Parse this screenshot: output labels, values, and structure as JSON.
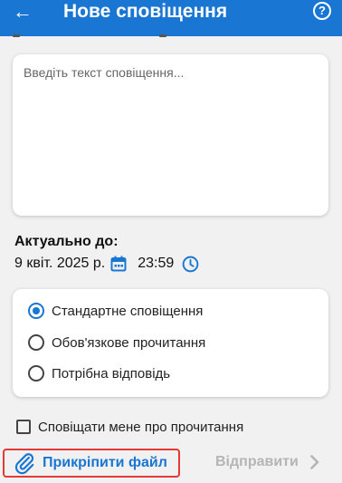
{
  "appbar": {
    "back_icon": "arrow-left-icon",
    "title": "Нове сповіщення",
    "help_icon": "help-circle-icon",
    "help_glyph": "?"
  },
  "message": {
    "placeholder": "Введіть текст сповіщення...",
    "value": ""
  },
  "expiry": {
    "label": "Актуально до:",
    "date": "9 квіт. 2025 р.",
    "date_icon": "calendar-icon",
    "time": "23:59",
    "time_icon": "clock-icon"
  },
  "notification_type": {
    "options": [
      {
        "label": "Стандартне сповіщення",
        "selected": true
      },
      {
        "label": "Обов'язкове прочитання",
        "selected": false
      },
      {
        "label": "Потрібна відповідь",
        "selected": false
      }
    ]
  },
  "read_receipt": {
    "label": "Сповіщати мене про прочитання",
    "checked": false
  },
  "footer": {
    "attach_icon": "paperclip-icon",
    "attach_label": "Прикріпити файл",
    "send_label": "Відправити",
    "send_icon": "chevron-right-icon"
  },
  "colors": {
    "primary": "#1976d2",
    "highlight_border": "#e53935",
    "disabled_text": "#b5b5b5",
    "background": "#f1f1f1"
  }
}
